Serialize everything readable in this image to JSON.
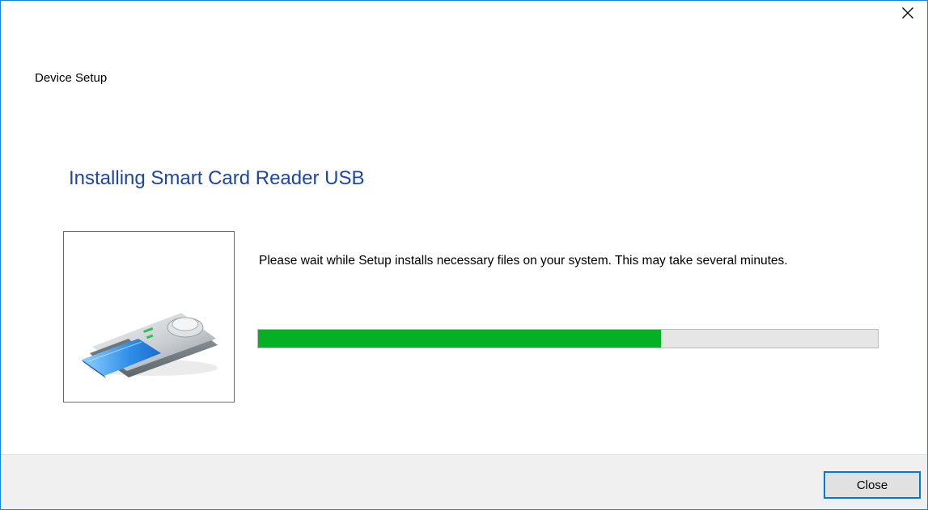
{
  "dialog": {
    "window_title": "Device Setup",
    "heading": "Installing Smart Card Reader USB",
    "message": "Please wait while Setup installs necessary files on your system. This may take several minutes.",
    "progress": 0.65,
    "close_icon": "close-x-icon",
    "device_icon": "smart-card-reader-icon",
    "close_button_label": "Close"
  },
  "colors": {
    "heading": "#1e45a8",
    "progress_fill": "#06b025",
    "progress_track": "#e6e6e6",
    "window_border": "#1883d7",
    "button_focus_border": "#0078d7",
    "footer_background": "#f0f0f0"
  }
}
